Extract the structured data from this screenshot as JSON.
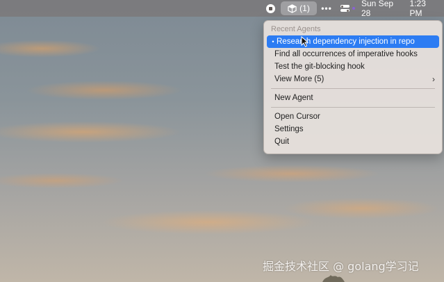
{
  "menubar": {
    "cursor_badge": "(1)",
    "more_glyph": "•••",
    "date": "Sun Sep 28",
    "time": "1:23 PM",
    "icons": [
      "record-stop-icon",
      "cursor-cube-icon",
      "more-dots-icon",
      "control-center-icon",
      "purple-status-dot"
    ]
  },
  "menu": {
    "section_header": "Recent Agents",
    "recent": [
      {
        "label": "Research dependency injection in repo",
        "selected": true
      },
      {
        "label": "Find all occurrences of imperative hooks"
      },
      {
        "label": "Test the git-blocking hook"
      }
    ],
    "view_more": "View More (5)",
    "new_agent": "New Agent",
    "open_cursor": "Open Cursor",
    "settings": "Settings",
    "quit": "Quit"
  },
  "watermark": "掘金技术社区 @ golang学习记",
  "colors": {
    "selection": "#2c7cf3",
    "status_dot": "#8a63d2"
  }
}
